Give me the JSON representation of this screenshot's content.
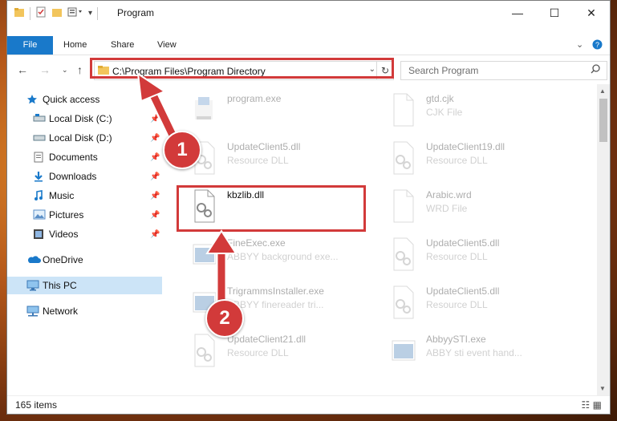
{
  "window": {
    "title": "Program"
  },
  "window_controls": {
    "minimize": "—",
    "maximize": "☐",
    "close": "✕"
  },
  "ribbon": {
    "tabs": [
      {
        "label": "File"
      },
      {
        "label": "Home"
      },
      {
        "label": "Share"
      },
      {
        "label": "View"
      }
    ]
  },
  "address_bar": {
    "path": "C:\\Program Files\\Program Directory"
  },
  "search": {
    "placeholder": "Search Program"
  },
  "nav_pane": {
    "items": [
      {
        "label": "Quick access",
        "icon": "star-icon"
      },
      {
        "label": "Local Disk (C:)",
        "icon": "drive-icon",
        "pinned": true
      },
      {
        "label": "Local Disk (D:)",
        "icon": "drive-icon",
        "pinned": true
      },
      {
        "label": "Documents",
        "icon": "documents-icon",
        "pinned": true
      },
      {
        "label": "Downloads",
        "icon": "download-icon",
        "pinned": true
      },
      {
        "label": "Music",
        "icon": "music-icon",
        "pinned": true
      },
      {
        "label": "Pictures",
        "icon": "pictures-icon",
        "pinned": true
      },
      {
        "label": "Videos",
        "icon": "videos-icon",
        "pinned": true
      },
      {
        "label": "OneDrive",
        "icon": "cloud-icon"
      },
      {
        "label": "This PC",
        "icon": "computer-icon",
        "selected": true
      },
      {
        "label": "Network",
        "icon": "network-icon"
      }
    ]
  },
  "files": [
    {
      "name": "program.exe",
      "desc": "",
      "icon": "exe-icon"
    },
    {
      "name": "gtd.cjk",
      "desc": "CJK File",
      "icon": "blank-file-icon"
    },
    {
      "name": "UpdateClient5.dll",
      "desc": "Resource DLL",
      "icon": "dll-icon"
    },
    {
      "name": "UpdateClient19.dll",
      "desc": "Resource DLL",
      "icon": "dll-icon"
    },
    {
      "name": "kbzlib.dll",
      "desc": "",
      "icon": "dll-icon",
      "highlighted": true
    },
    {
      "name": "Arabic.wrd",
      "desc": "WRD File",
      "icon": "blank-file-icon"
    },
    {
      "name": "FineExec.exe",
      "desc": "ABBYY background exe...",
      "icon": "app-icon"
    },
    {
      "name": "UpdateClient5.dll",
      "desc": "Resource DLL",
      "icon": "dll-icon"
    },
    {
      "name": "TrigrammsInstaller.exe",
      "desc": "ABBYY finereader tri...",
      "icon": "app-icon"
    },
    {
      "name": "UpdateClient5.dll",
      "desc": "Resource DLL",
      "icon": "dll-icon"
    },
    {
      "name": "UpdateClient21.dll",
      "desc": "Resource DLL",
      "icon": "dll-icon"
    },
    {
      "name": "AbbyySTI.exe",
      "desc": "ABBY sti event hand...",
      "icon": "app-icon"
    }
  ],
  "status": {
    "count": "165 items"
  },
  "annotations": {
    "step1": "1",
    "step2": "2"
  },
  "colors": {
    "accent": "#1979ca",
    "highlight": "#d23a3a",
    "selected": "#cce4f7"
  }
}
